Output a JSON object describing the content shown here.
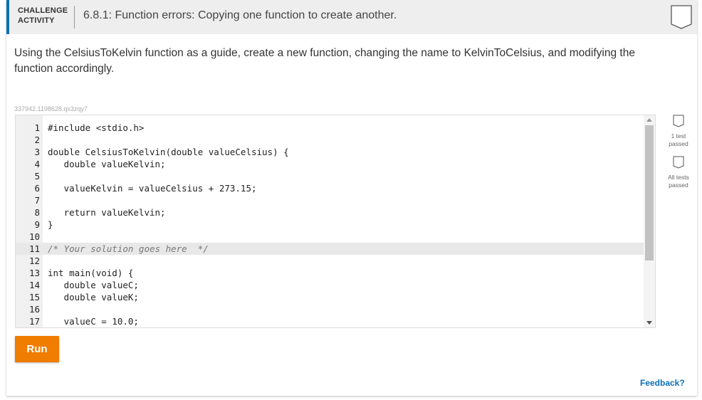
{
  "header": {
    "badge_line1": "CHALLENGE",
    "badge_line2": "ACTIVITY",
    "title": "6.8.1: Function errors: Copying one function to create another.",
    "bookmark_icon": "bookmark-icon"
  },
  "description": "Using the CelsiusToKelvin function as a guide, create a new function, changing the name to KelvinToCelsius, and modifying the function accordingly.",
  "code_id": "337942.1198628.qx3zqy7",
  "editor": {
    "lines": [
      {
        "n": "1",
        "text": "#include <stdio.h>"
      },
      {
        "n": "2",
        "text": ""
      },
      {
        "n": "3",
        "text": "double CelsiusToKelvin(double valueCelsius) {"
      },
      {
        "n": "4",
        "text": "   double valueKelvin;"
      },
      {
        "n": "5",
        "text": ""
      },
      {
        "n": "6",
        "text": "   valueKelvin = valueCelsius + 273.15;"
      },
      {
        "n": "7",
        "text": ""
      },
      {
        "n": "8",
        "text": "   return valueKelvin;"
      },
      {
        "n": "9",
        "text": "}"
      },
      {
        "n": "10",
        "text": ""
      },
      {
        "n": "11",
        "text": "/* Your solution goes here  */"
      },
      {
        "n": "12",
        "text": ""
      },
      {
        "n": "13",
        "text": "int main(void) {"
      },
      {
        "n": "14",
        "text": "   double valueC;"
      },
      {
        "n": "15",
        "text": "   double valueK;"
      },
      {
        "n": "16",
        "text": ""
      },
      {
        "n": "17",
        "text": "   valueC = 10.0;"
      }
    ],
    "active_line": "11"
  },
  "status": {
    "test1_label_a": "1 test",
    "test1_label_b": "passed",
    "all_label_a": "All tests",
    "all_label_b": "passed"
  },
  "run_label": "Run",
  "feedback_label": "Feedback?",
  "colors": {
    "accent": "#0d6fb5",
    "run_button": "#f07c00"
  }
}
